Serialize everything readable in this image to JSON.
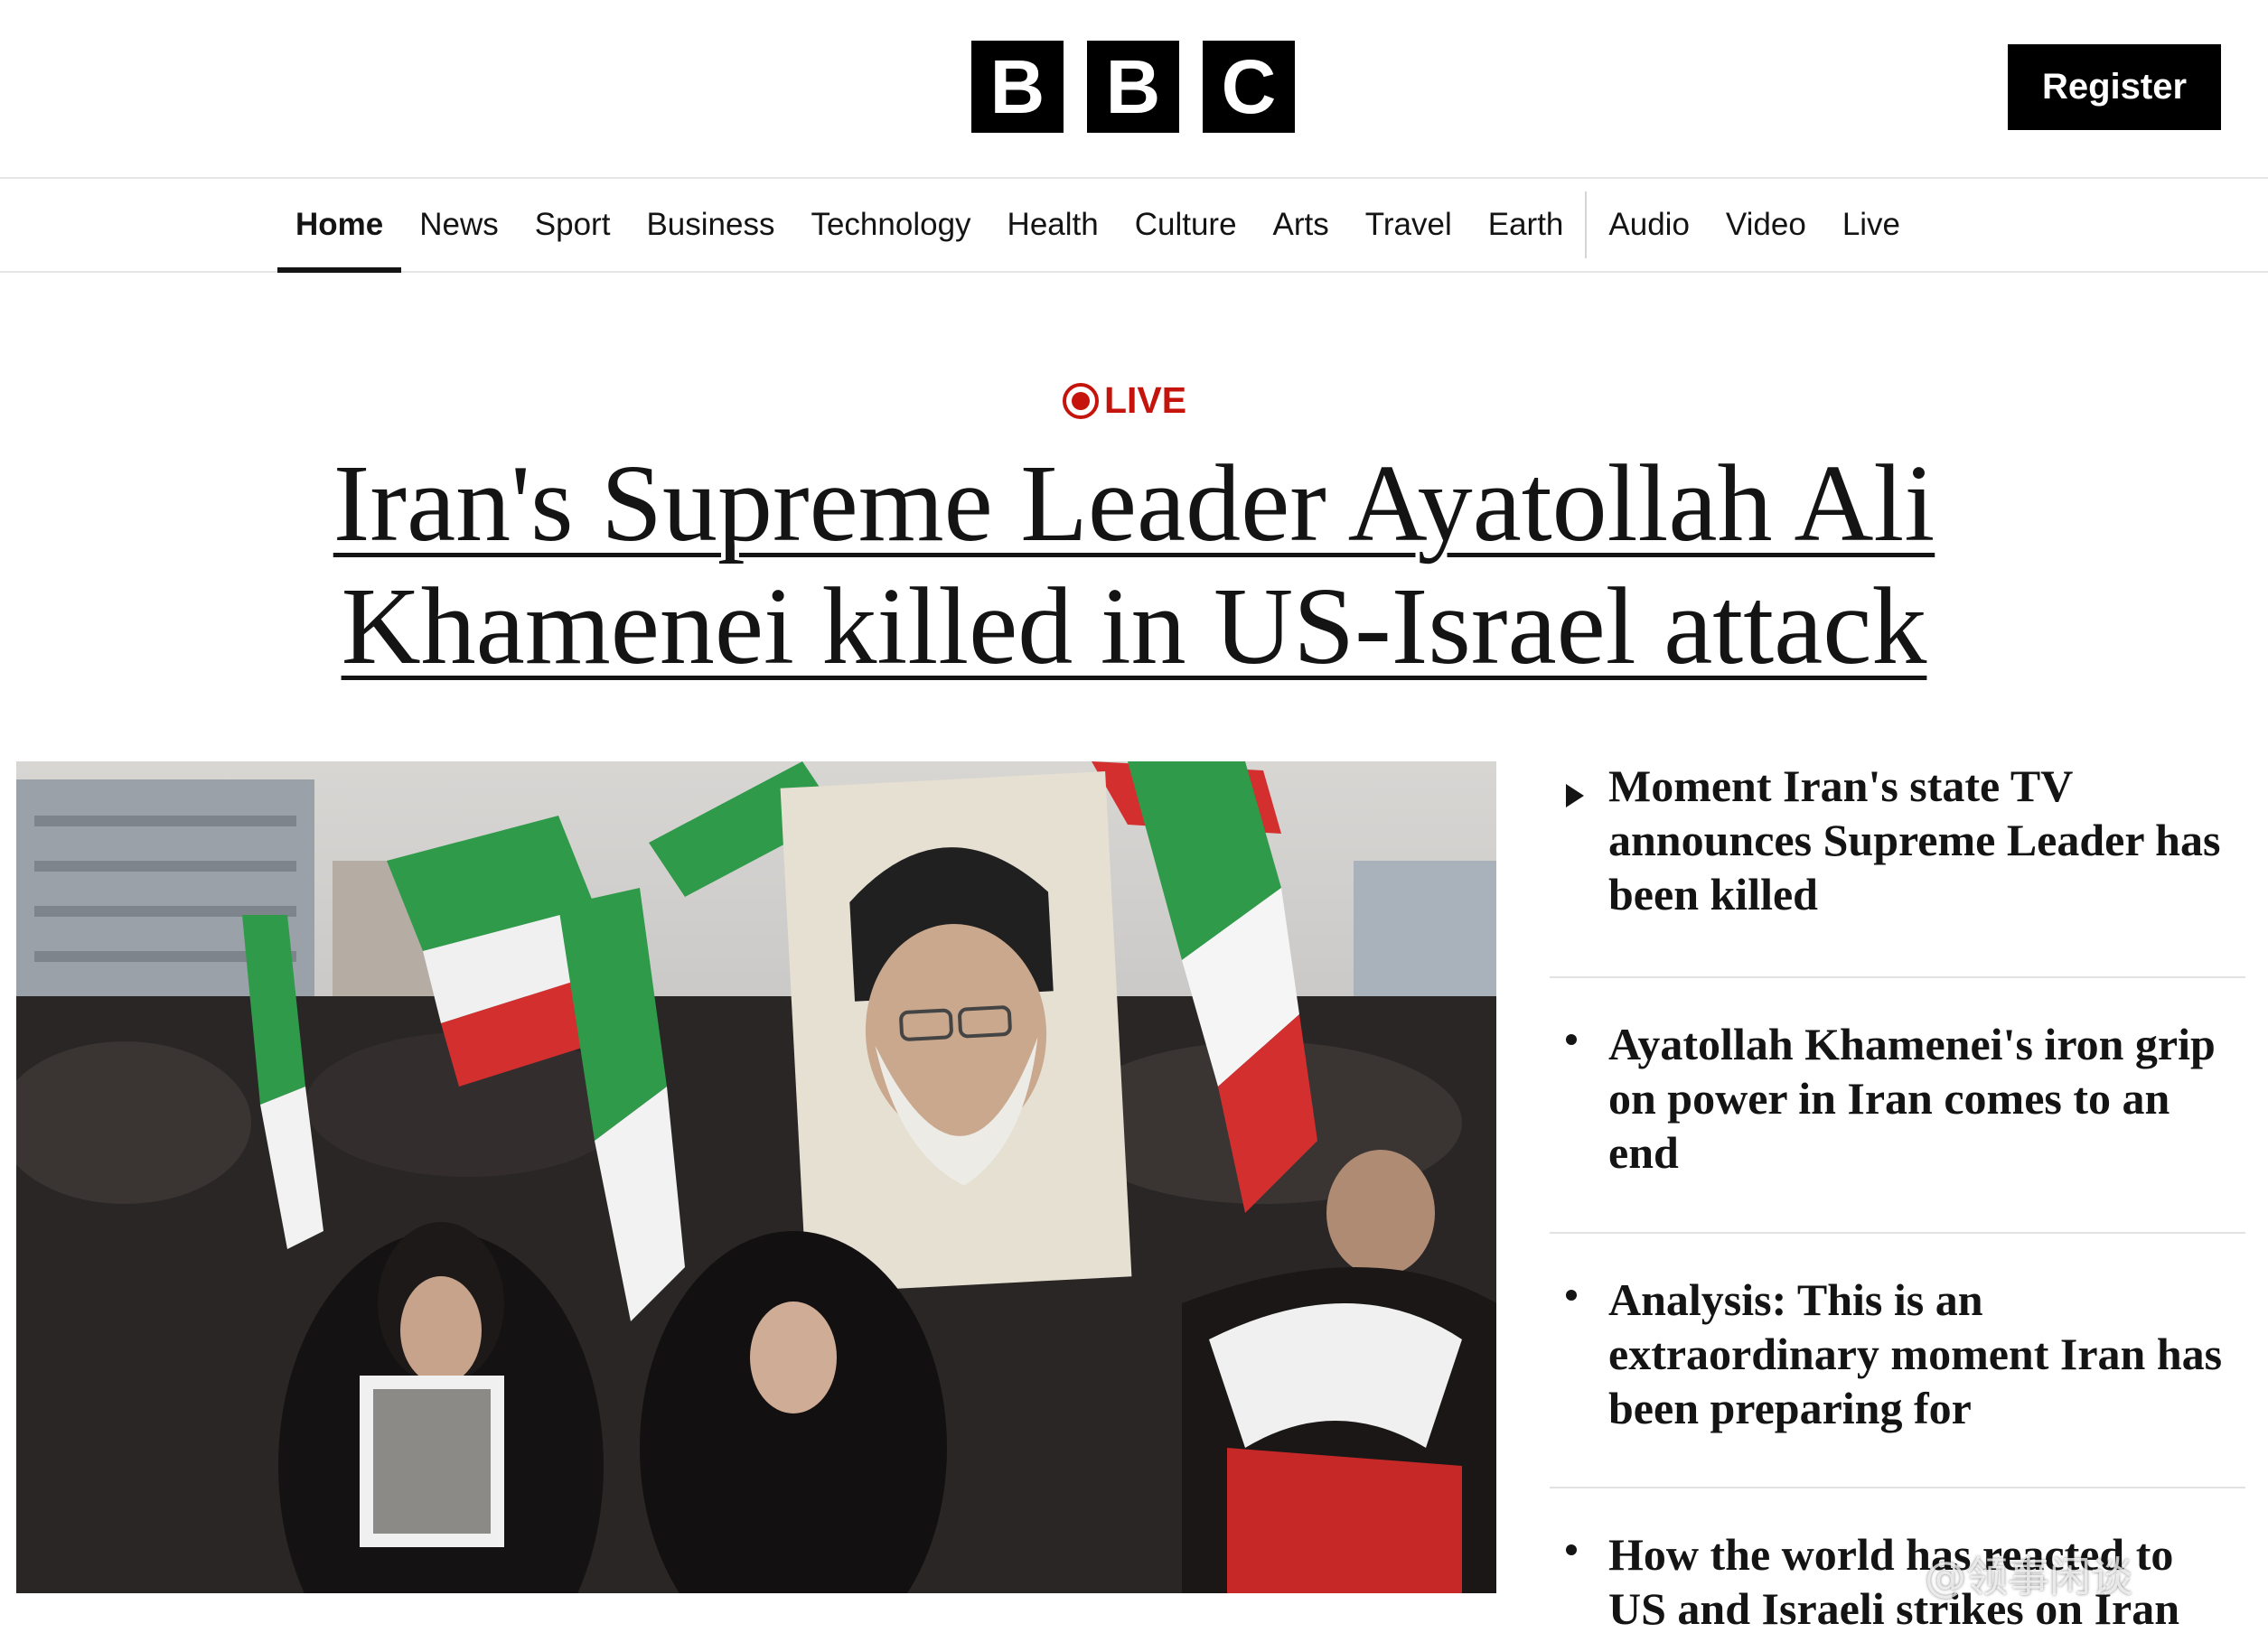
{
  "header": {
    "logo_letters": [
      "B",
      "B",
      "C"
    ],
    "register_label": "Register"
  },
  "nav": {
    "items": [
      {
        "label": "Home",
        "active": true
      },
      {
        "label": "News"
      },
      {
        "label": "Sport"
      },
      {
        "label": "Business"
      },
      {
        "label": "Technology"
      },
      {
        "label": "Health"
      },
      {
        "label": "Culture"
      },
      {
        "label": "Arts"
      },
      {
        "label": "Travel"
      },
      {
        "label": "Earth"
      },
      {
        "label": "Audio"
      },
      {
        "label": "Video"
      },
      {
        "label": "Live"
      }
    ]
  },
  "hero": {
    "live_label": "LIVE",
    "headline": "Iran's Supreme Leader Ayatollah Ali Khamenei killed in US-Israel attack"
  },
  "sidebar": {
    "items": [
      {
        "text": "Moment Iran's state TV announces Supreme Leader has been killed",
        "marker": "play-icon"
      },
      {
        "text": "Ayatollah Khamenei's iron grip on power in Iran comes to an end",
        "marker": "bullet"
      },
      {
        "text": "Analysis: This is an extraordinary moment Iran has been preparing for",
        "marker": "bullet"
      },
      {
        "text": "How the world has reacted to US and Israeli strikes on Iran",
        "marker": "bullet"
      }
    ]
  },
  "watermark": "@领事闲谈",
  "colors": {
    "live_red": "#c4140c",
    "text": "#141414",
    "brand_black": "#000000"
  }
}
